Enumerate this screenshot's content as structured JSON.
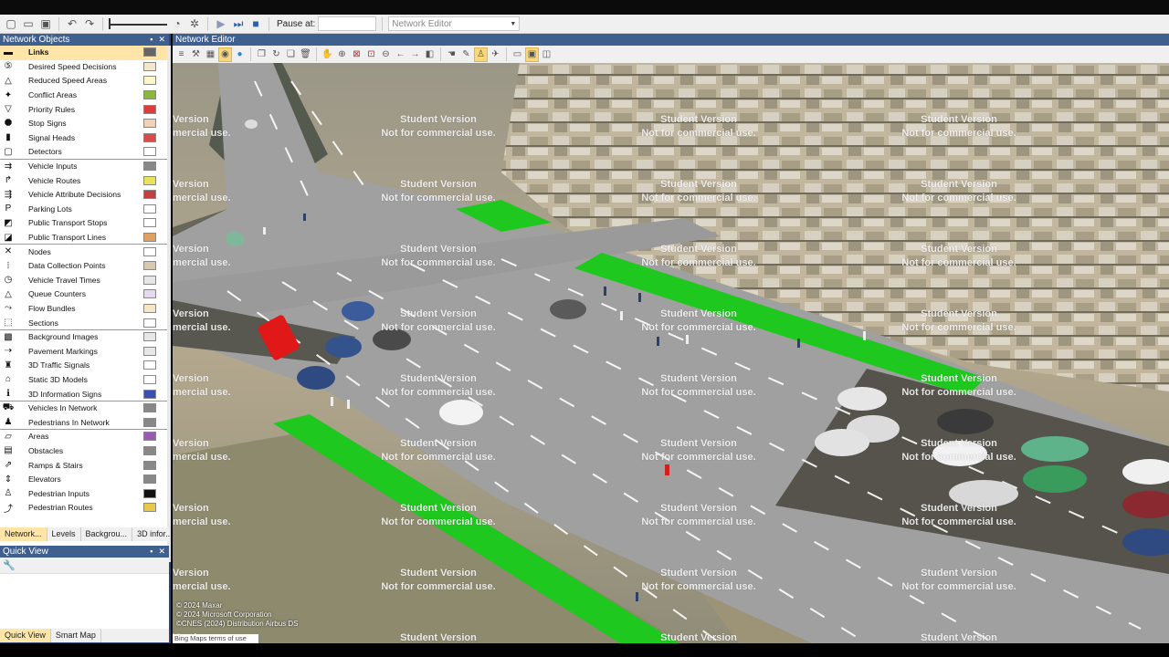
{
  "toolbar": {
    "pause_label": "Pause at:",
    "pause_value": "",
    "editor_combo": "Network Editor"
  },
  "panels": {
    "network_objects_title": "Network Objects",
    "network_editor_title": "Network Editor",
    "quick_view_title": "Quick View"
  },
  "network_objects": [
    {
      "label": "Links",
      "icon": "links-icon",
      "selected": true,
      "swatch": "#666666",
      "sep": false
    },
    {
      "label": "Desired Speed Decisions",
      "icon": "speed-sign-icon",
      "swatch": "#f4e7c9",
      "sep": false
    },
    {
      "label": "Reduced Speed Areas",
      "icon": "triangle-warning-icon",
      "swatch": "#fff7cc",
      "sep": false
    },
    {
      "label": "Conflict Areas",
      "icon": "conflict-icon",
      "swatch": "#8bb83a",
      "sep": false
    },
    {
      "label": "Priority Rules",
      "icon": "yield-icon",
      "swatch": "#e03b3b",
      "sep": false
    },
    {
      "label": "Stop Signs",
      "icon": "stop-sign-icon",
      "swatch": "#f3d1b5",
      "sep": false
    },
    {
      "label": "Signal Heads",
      "icon": "traffic-light-icon",
      "swatch": "#d94a4a",
      "sep": false
    },
    {
      "label": "Detectors",
      "icon": "detector-icon",
      "swatch": "#ffffff",
      "sep": true
    },
    {
      "label": "Vehicle Inputs",
      "icon": "vehicle-input-icon",
      "swatch": "#888888",
      "sep": false
    },
    {
      "label": "Vehicle Routes",
      "icon": "vehicle-route-icon",
      "swatch": "#e8e35a",
      "sep": false
    },
    {
      "label": "Vehicle Attribute Decisions",
      "icon": "attribute-decision-icon",
      "swatch": "#c24040",
      "sep": false
    },
    {
      "label": "Parking Lots",
      "icon": "parking-icon",
      "swatch": "#ffffff",
      "sep": false
    },
    {
      "label": "Public Transport Stops",
      "icon": "pt-stop-icon",
      "swatch": "#ffffff",
      "sep": false
    },
    {
      "label": "Public Transport Lines",
      "icon": "pt-line-icon",
      "swatch": "#e0a060",
      "sep": true
    },
    {
      "label": "Nodes",
      "icon": "nodes-icon",
      "swatch": "#ffffff",
      "sep": false
    },
    {
      "label": "Data Collection Points",
      "icon": "data-collection-icon",
      "swatch": "#d7c8b0",
      "sep": false
    },
    {
      "label": "Vehicle Travel Times",
      "icon": "travel-time-icon",
      "swatch": "#e6e6e6",
      "sep": false
    },
    {
      "label": "Queue Counters",
      "icon": "queue-counter-icon",
      "swatch": "#e6d8f0",
      "sep": false
    },
    {
      "label": "Flow Bundles",
      "icon": "flow-bundle-icon",
      "swatch": "#f5e6c4",
      "sep": false
    },
    {
      "label": "Sections",
      "icon": "sections-icon",
      "swatch": "#ffffff",
      "sep": true
    },
    {
      "label": "Background Images",
      "icon": "background-image-icon",
      "swatch": "#e6e6e6",
      "sep": false
    },
    {
      "label": "Pavement Markings",
      "icon": "pavement-marking-icon",
      "swatch": "#e6e6e6",
      "sep": false
    },
    {
      "label": "3D Traffic Signals",
      "icon": "3d-signal-icon",
      "swatch": "#ffffff",
      "sep": false
    },
    {
      "label": "Static 3D Models",
      "icon": "static-model-icon",
      "swatch": "#ffffff",
      "sep": false
    },
    {
      "label": "3D Information Signs",
      "icon": "info-sign-icon",
      "swatch": "#3a4fb0",
      "sep": true
    },
    {
      "label": "Vehicles In Network",
      "icon": "vehicles-network-icon",
      "swatch": "#888888",
      "sep": false
    },
    {
      "label": "Pedestrians In Network",
      "icon": "pedestrians-network-icon",
      "swatch": "#888888",
      "sep": true
    },
    {
      "label": "Areas",
      "icon": "areas-icon",
      "swatch": "#9b59b6",
      "sep": false
    },
    {
      "label": "Obstacles",
      "icon": "obstacles-icon",
      "swatch": "#888888",
      "sep": false
    },
    {
      "label": "Ramps & Stairs",
      "icon": "ramps-icon",
      "swatch": "#888888",
      "sep": false
    },
    {
      "label": "Elevators",
      "icon": "elevator-icon",
      "swatch": "#888888",
      "sep": false
    },
    {
      "label": "Pedestrian Inputs",
      "icon": "pedestrian-input-icon",
      "swatch": "#111111",
      "sep": false
    },
    {
      "label": "Pedestrian Routes",
      "icon": "pedestrian-route-icon",
      "swatch": "#e8c84a",
      "sep": false
    }
  ],
  "left_tabs": [
    "Network...",
    "Levels",
    "Backgrou...",
    "3D infor..."
  ],
  "bottom_tabs": [
    "Quick View",
    "Smart Map"
  ],
  "watermark": {
    "line1": "Student Version",
    "line2": "Not for commercial use.",
    "partial1": "Version",
    "partial2": "mercial use."
  },
  "map_credits": [
    "© 2024 Maxar",
    "© 2024 Microsoft Corporation",
    "©CNES (2024) Distribution Airbus DS"
  ],
  "bing_text": "Bing Maps terms of use"
}
